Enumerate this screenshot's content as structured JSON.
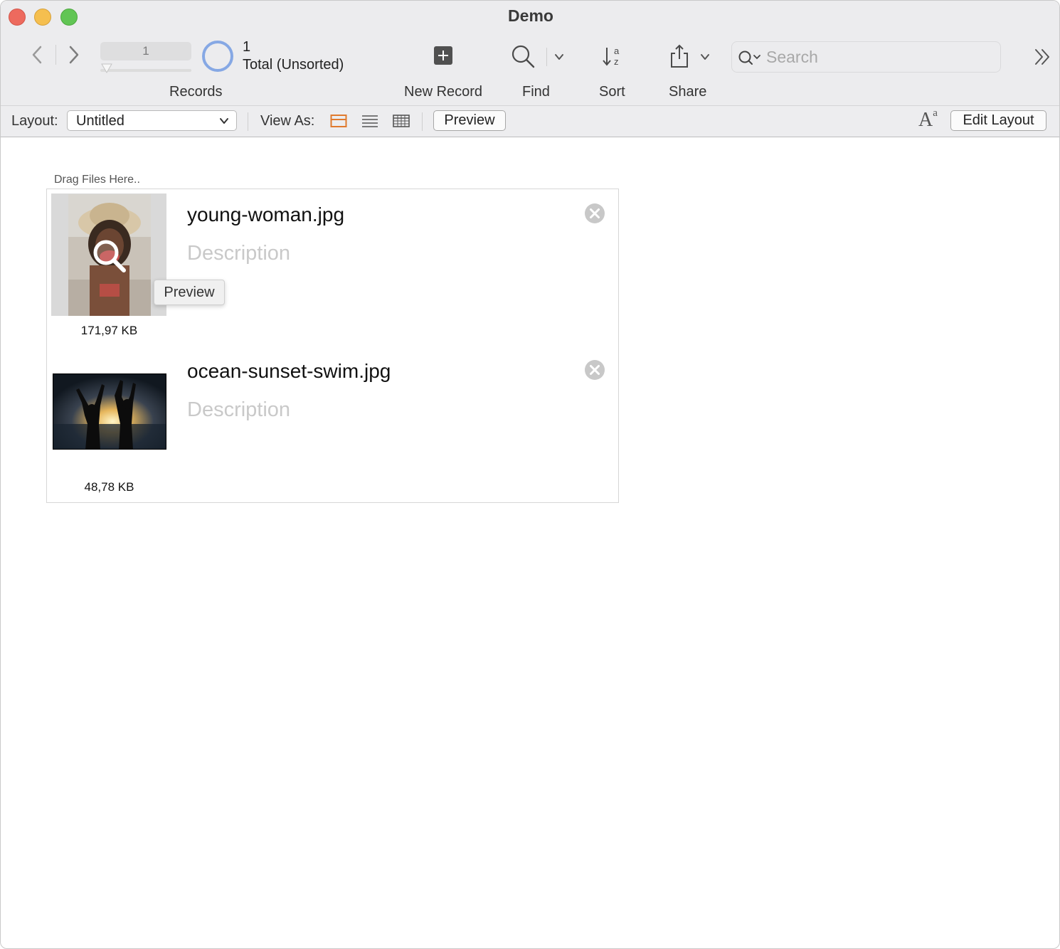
{
  "window": {
    "title": "Demo"
  },
  "toolbar": {
    "record_number": "1",
    "record_count": "1",
    "record_status": "Total (Unsorted)",
    "records_label": "Records",
    "new_record_label": "New Record",
    "find_label": "Find",
    "sort_label": "Sort",
    "share_label": "Share",
    "search_placeholder": "Search"
  },
  "layout_bar": {
    "layout_label": "Layout:",
    "layout_value": "Untitled",
    "view_as_label": "View As:",
    "preview_button": "Preview",
    "edit_layout_button": "Edit Layout",
    "active_view": "form",
    "accent_color": "#e07a2e"
  },
  "content": {
    "drag_label": "Drag Files Here..",
    "tooltip": "Preview",
    "files": [
      {
        "name": "young-woman.jpg",
        "description_placeholder": "Description",
        "size": "171,97 KB"
      },
      {
        "name": "ocean-sunset-swim.jpg",
        "description_placeholder": "Description",
        "size": "48,78 KB"
      }
    ]
  },
  "icons": {
    "nav_prev": "chevron-left-icon",
    "nav_next": "chevron-right-icon",
    "new_record": "plus-square-icon",
    "find": "magnifier-icon",
    "sort": "sort-az-icon",
    "share": "share-icon",
    "overflow": "double-chevron-icon",
    "remove": "close-circle-icon"
  }
}
